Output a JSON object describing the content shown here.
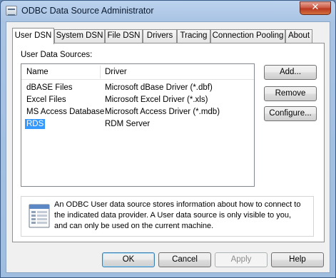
{
  "window": {
    "title": "ODBC Data Source Administrator",
    "close_glyph": "✕"
  },
  "tabs": [
    {
      "label": "User DSN",
      "active": true
    },
    {
      "label": "System DSN"
    },
    {
      "label": "File DSN"
    },
    {
      "label": "Drivers"
    },
    {
      "label": "Tracing"
    },
    {
      "label": "Connection Pooling"
    },
    {
      "label": "About"
    }
  ],
  "user_dsn": {
    "list_label": "User Data Sources:",
    "columns": [
      "Name",
      "Driver"
    ],
    "rows": [
      {
        "name": "dBASE Files",
        "driver": "Microsoft dBase Driver (*.dbf)"
      },
      {
        "name": "Excel Files",
        "driver": "Microsoft Excel Driver (*.xls)"
      },
      {
        "name": "MS Access Database",
        "driver": "Microsoft Access Driver (*.mdb)"
      },
      {
        "name": "RDS",
        "driver": "RDM Server",
        "selected": true
      }
    ],
    "buttons": {
      "add": "Add...",
      "remove": "Remove",
      "configure": "Configure..."
    },
    "info_icon": "datasource-icon",
    "info_lines": [
      "An ODBC User data source stores information about how to connect to",
      "the indicated data provider.   A User data source is only visible to you,",
      "and can only be used on the current machine."
    ]
  },
  "footer": {
    "ok": "OK",
    "cancel": "Cancel",
    "apply": "Apply",
    "help": "Help"
  },
  "colors": {
    "selection": "#3399ff",
    "close_button": "#c8523c",
    "title_bar": "#a9c3e3"
  }
}
